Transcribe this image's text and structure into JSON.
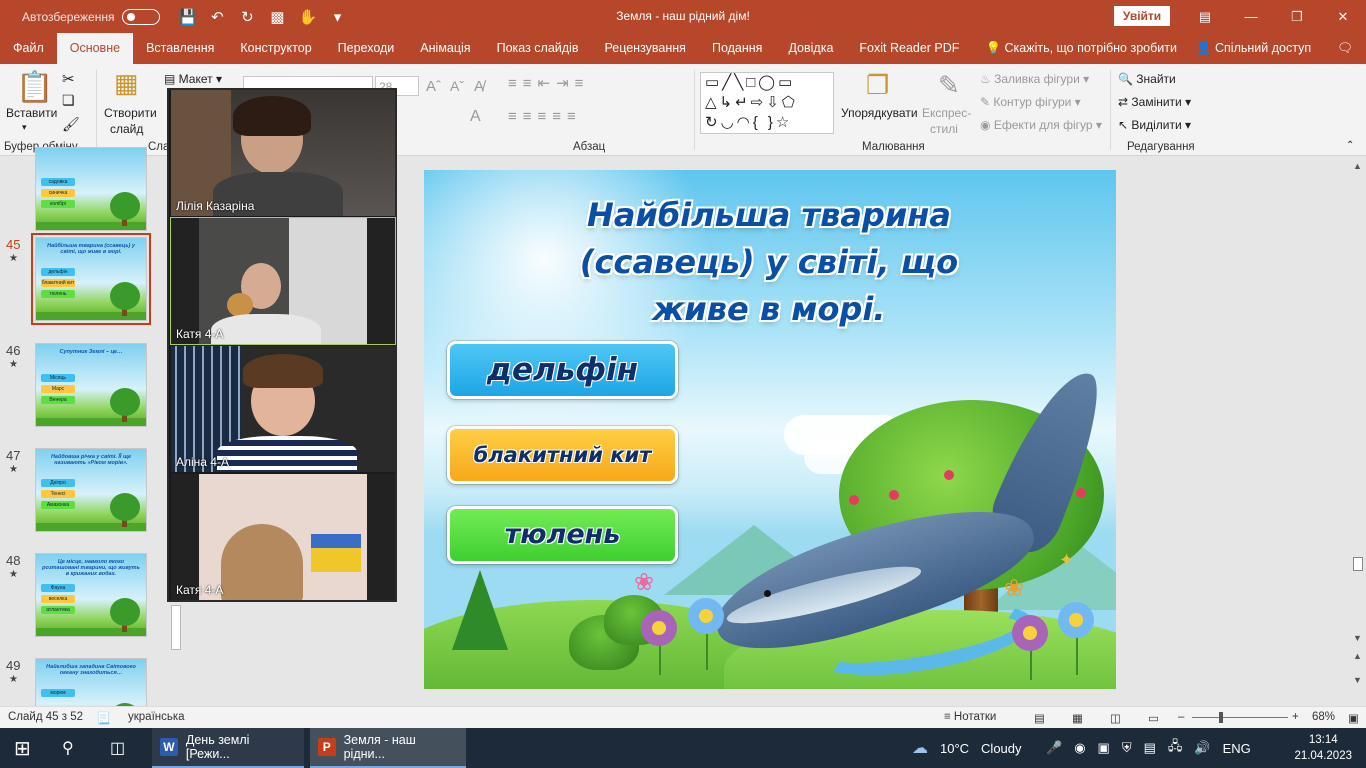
{
  "titlebar": {
    "autosave_label": "Автозбереження",
    "doc_title": "Земля - наш рідний дім!",
    "signin": "Увійти"
  },
  "tabs": [
    "Файл",
    "Основне",
    "Вставлення",
    "Конструктор",
    "Переходи",
    "Анімація",
    "Показ слайдів",
    "Рецензування",
    "Подання",
    "Довідка",
    "Foxit Reader PDF"
  ],
  "tell_me": "Скажіть, що потрібно зробити",
  "share": "Спільний доступ",
  "ribbon": {
    "paste": "Вставити",
    "clipboard_group": "Буфер обміну",
    "new_slide_1": "Створити",
    "new_slide_2": "слайд",
    "layout": "Макет",
    "slides_group": "Сла",
    "font_size": "28",
    "paragraph_group": "Абзац",
    "arrange": "Упорядкувати",
    "quick_styles_1": "Експрес-",
    "quick_styles_2": "стилі",
    "shape_fill": "Заливка фігури",
    "shape_outline": "Контур фігури",
    "shape_effects": "Ефекти для фігур",
    "drawing_group": "Малювання",
    "find": "Знайти",
    "replace": "Замінити",
    "select": "Виділити",
    "editing_group": "Редагування"
  },
  "thumbnails": [
    {
      "num": "",
      "star": "",
      "title": "",
      "answers": [
        "садовка",
        "синичка",
        "колібрі"
      ],
      "colors": [
        "#3fc0f0",
        "#ffc640",
        "#5ede40"
      ]
    },
    {
      "num": "45",
      "star": "★",
      "title": "Найбільша тварина (ссавець) у світі, що живе в морі.",
      "answers": [
        "дельфін",
        "блакитний кит",
        "тюлень"
      ],
      "colors": [
        "#3fc0f0",
        "#ffc640",
        "#5ede40"
      ]
    },
    {
      "num": "46",
      "star": "★",
      "title": "Супутник Землі – це…",
      "answers": [
        "Місяць",
        "Марс",
        "Венера"
      ],
      "colors": [
        "#3fc0f0",
        "#ffc640",
        "#5ede40"
      ]
    },
    {
      "num": "47",
      "star": "★",
      "title": "Найдовша річка у світі. ЇЇ ще називають «Ріком морів».",
      "answers": [
        "Дніпро",
        "Тенесі",
        "Амазонка"
      ],
      "colors": [
        "#3fc0f0",
        "#ffc640",
        "#5ede40"
      ]
    },
    {
      "num": "48",
      "star": "★",
      "title": "Це місце, навколо якого розташовані тварини, що живуть в крижаних водах.",
      "answers": [
        "Фауна",
        "веселка",
        "атлантика"
      ],
      "colors": [
        "#3fc0f0",
        "#ffc640",
        "#5ede40"
      ]
    },
    {
      "num": "49",
      "star": "★",
      "title": "Найглибша западина Світового океану знаходиться…",
      "answers": [
        "морем"
      ],
      "colors": [
        "#3fc0f0"
      ]
    }
  ],
  "slide": {
    "title": "Найбільша тварина (ссавець) у світі, що живе в морі.",
    "answers": [
      "дельфін",
      "блакитний кит",
      "тюлень"
    ]
  },
  "participants": [
    "Лілія Казаріна",
    "Катя 4-А",
    "Аліна 4-А",
    "Катя  4-А"
  ],
  "status": {
    "slide_counter": "Слайд 45 з 52",
    "language": "українська",
    "notes": "Нотатки",
    "zoom": "68%"
  },
  "taskbar": {
    "app1": "День землі [Режи...",
    "app2": "Земля - наш рідни...",
    "weather_temp": "10°C",
    "weather_desc": "Cloudy",
    "lang": "ENG",
    "time": "13:14",
    "date": "21.04.2023"
  }
}
